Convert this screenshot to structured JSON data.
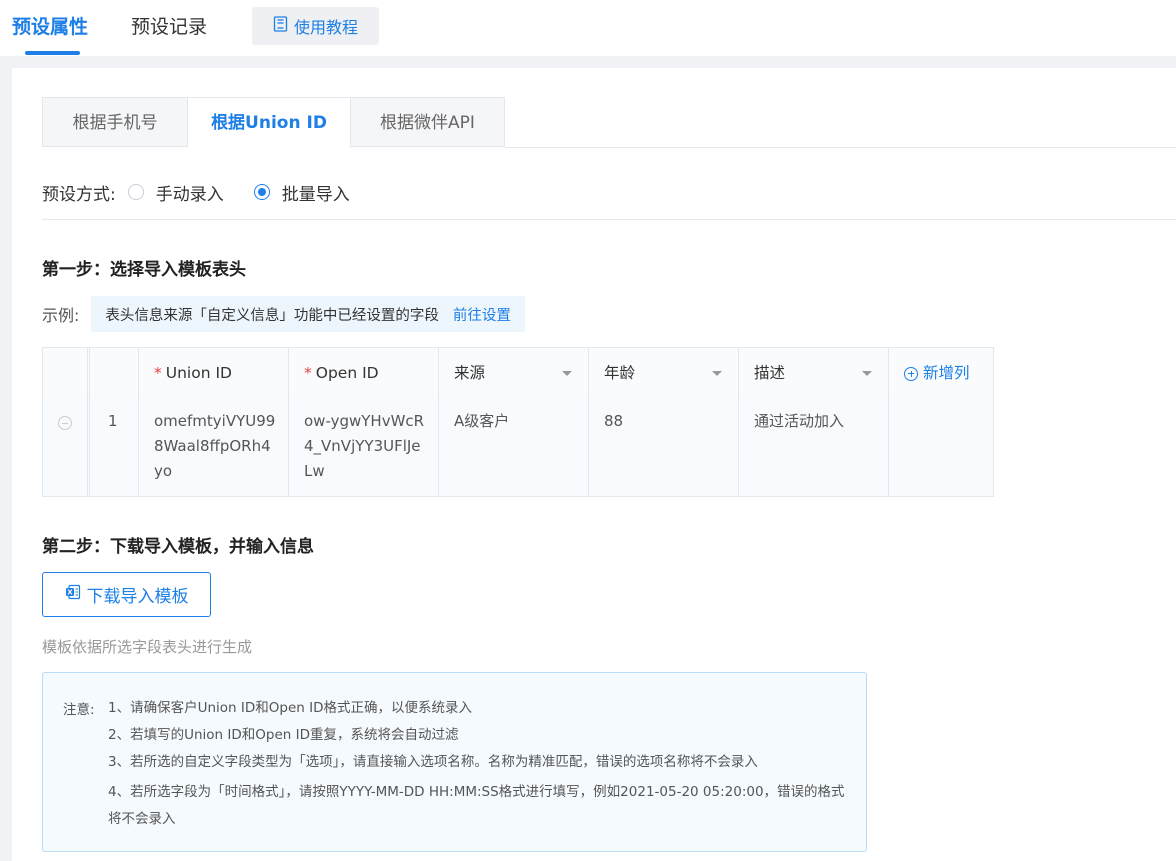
{
  "top_tabs": [
    {
      "label": "预设属性",
      "active": true
    },
    {
      "label": "预设记录",
      "active": false
    }
  ],
  "tutorial_button": {
    "label": "使用教程",
    "icon": "book-icon"
  },
  "sub_tabs": [
    {
      "label": "根据手机号",
      "active": false
    },
    {
      "label": "根据Union ID",
      "active": true
    },
    {
      "label": "根据微伴API",
      "active": false
    }
  ],
  "preset_mode": {
    "label": "预设方式:",
    "options": [
      {
        "label": "手动录入",
        "checked": false
      },
      {
        "label": "批量导入",
        "checked": true
      }
    ]
  },
  "step1": {
    "title": "第一步：选择导入模板表头",
    "example_label": "示例:",
    "example_text": "表头信息来源「自定义信息」功能中已经设置的字段",
    "example_link": "前往设置"
  },
  "table": {
    "headers": [
      {
        "label": "Union ID",
        "required": true,
        "dropdown": false
      },
      {
        "label": "Open ID",
        "required": true,
        "dropdown": false
      },
      {
        "label": "来源",
        "required": false,
        "dropdown": true
      },
      {
        "label": "年龄",
        "required": false,
        "dropdown": true
      },
      {
        "label": "描述",
        "required": false,
        "dropdown": true
      }
    ],
    "add_column_label": "新增列",
    "required_mark": "*",
    "rows": [
      {
        "index": "1",
        "cells": [
          "omefmtyiVYU998Waal8ffpORh4yo",
          "ow-ygwYHvWcR4_VnVjYY3UFlJeLw",
          "A级客户",
          "88",
          "通过活动加入"
        ]
      }
    ]
  },
  "step2": {
    "title": "第二步：下载导入模板，并输入信息",
    "download_button": "下载导入模板",
    "hint": "模板依据所选字段表头进行生成"
  },
  "notice": {
    "label": "注意:",
    "lines": [
      "1、请确保客户Union ID和Open ID格式正确，以便系统录入",
      "2、若填写的Union ID和Open ID重复，系统将会自动过滤",
      "3、若所选的自定义字段类型为「选项」，请直接输入选项名称。名称为精准匹配，错误的选项名称将不会录入",
      "4、若所选字段为「时间格式」，请按照YYYY-MM-DD HH:MM:SS格式进行填写，例如2021-05-20 05:20:00，错误的格式将不会录入"
    ]
  },
  "colors": {
    "accent": "#1e7fe6",
    "required": "#e64340"
  }
}
